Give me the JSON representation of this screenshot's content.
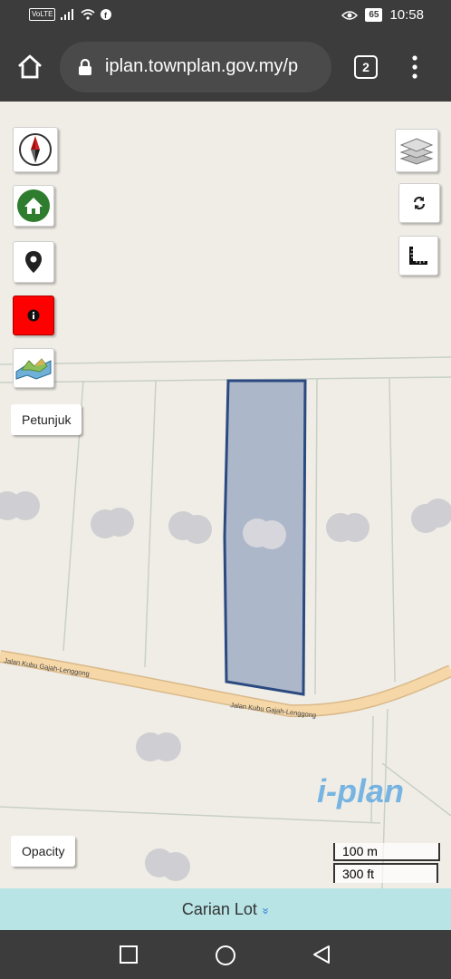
{
  "status_bar": {
    "volte": "VoLTE",
    "battery": "65",
    "time": "10:58"
  },
  "browser": {
    "url": "iplan.townplan.gov.my/p",
    "tab_count": "2"
  },
  "map": {
    "road_label_1": "Jalan Kubu Gajah-Lenggong",
    "road_label_2": "Jalan Kubu Gajah-Lenggong",
    "petunjuk_label": "Petunjuk",
    "opacity_label": "Opacity",
    "scale_metric": "100 m",
    "scale_imperial": "300 ft",
    "logo_text": "i-plan",
    "colors": {
      "parcel_fill": "#a9b4c8",
      "parcel_stroke": "#2a4a80",
      "road": "#f5d7a8",
      "info_button": "#ff0000",
      "home_icon": "#2e7d2e"
    }
  },
  "bottom_bar": {
    "carian_label": "Carian Lot",
    "chevron": "»"
  }
}
